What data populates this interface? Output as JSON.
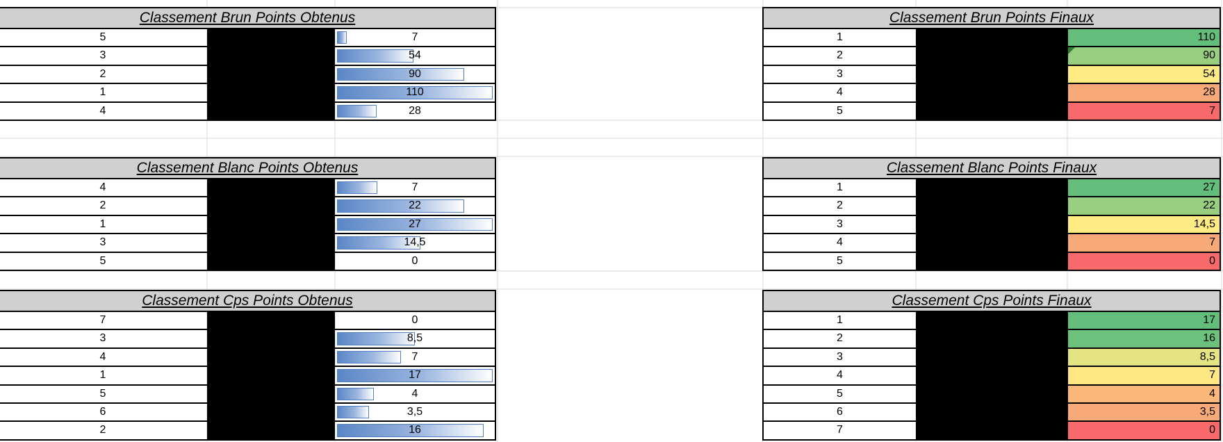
{
  "tables_left": [
    {
      "id": "brun",
      "title": "Classement Brun Points Obtenus",
      "max": 110,
      "rows": [
        {
          "rank": "5",
          "value": 7,
          "label": "7"
        },
        {
          "rank": "3",
          "value": 54,
          "label": "54"
        },
        {
          "rank": "2",
          "value": 90,
          "label": "90"
        },
        {
          "rank": "1",
          "value": 110,
          "label": "110"
        },
        {
          "rank": "4",
          "value": 28,
          "label": "28"
        }
      ]
    },
    {
      "id": "blanc",
      "title": "Classement Blanc Points Obtenus",
      "max": 27,
      "rows": [
        {
          "rank": "4",
          "value": 7,
          "label": "7"
        },
        {
          "rank": "2",
          "value": 22,
          "label": "22"
        },
        {
          "rank": "1",
          "value": 27,
          "label": "27"
        },
        {
          "rank": "3",
          "value": 14.5,
          "label": "14,5"
        },
        {
          "rank": "5",
          "value": 0,
          "label": "0"
        }
      ]
    },
    {
      "id": "cps",
      "title": "Classement Cps Points Obtenus",
      "max": 17,
      "rows": [
        {
          "rank": "7",
          "value": 0,
          "label": "0"
        },
        {
          "rank": "3",
          "value": 8.5,
          "label": "8,5"
        },
        {
          "rank": "4",
          "value": 7,
          "label": "7"
        },
        {
          "rank": "1",
          "value": 17,
          "label": "17"
        },
        {
          "rank": "5",
          "value": 4,
          "label": "4"
        },
        {
          "rank": "6",
          "value": 3.5,
          "label": "3,5"
        },
        {
          "rank": "2",
          "value": 16,
          "label": "16"
        }
      ]
    }
  ],
  "tables_right": [
    {
      "id": "brun-final",
      "title": "Classement Brun Points Finaux",
      "rows": [
        {
          "rank": "1",
          "label": "110",
          "color": "#63be7b"
        },
        {
          "rank": "2",
          "label": "90",
          "color": "#98ce7f",
          "comment_marker": true
        },
        {
          "rank": "3",
          "label": "54",
          "color": "#ffeb84"
        },
        {
          "rank": "4",
          "label": "28",
          "color": "#f8a978"
        },
        {
          "rank": "5",
          "label": "7",
          "color": "#f8696b"
        }
      ]
    },
    {
      "id": "blanc-final",
      "title": "Classement Blanc Points Finaux",
      "rows": [
        {
          "rank": "1",
          "label": "27",
          "color": "#63be7b"
        },
        {
          "rank": "2",
          "label": "22",
          "color": "#98ce7f"
        },
        {
          "rank": "3",
          "label": "14,5",
          "color": "#ffeb84"
        },
        {
          "rank": "4",
          "label": "7",
          "color": "#f8a978"
        },
        {
          "rank": "5",
          "label": "0",
          "color": "#f8696b"
        }
      ]
    },
    {
      "id": "cps-final",
      "title": "Classement Cps Points Finaux",
      "rows": [
        {
          "rank": "1",
          "label": "17",
          "color": "#63be7b"
        },
        {
          "rank": "2",
          "label": "16",
          "color": "#6cc17c"
        },
        {
          "rank": "3",
          "label": "8,5",
          "color": "#e4e483"
        },
        {
          "rank": "4",
          "label": "7",
          "color": "#ffe884"
        },
        {
          "rank": "5",
          "label": "4",
          "color": "#fcb77a"
        },
        {
          "rank": "6",
          "label": "3,5",
          "color": "#f8a978"
        },
        {
          "rank": "7",
          "label": "0",
          "color": "#f8696b"
        }
      ]
    }
  ]
}
